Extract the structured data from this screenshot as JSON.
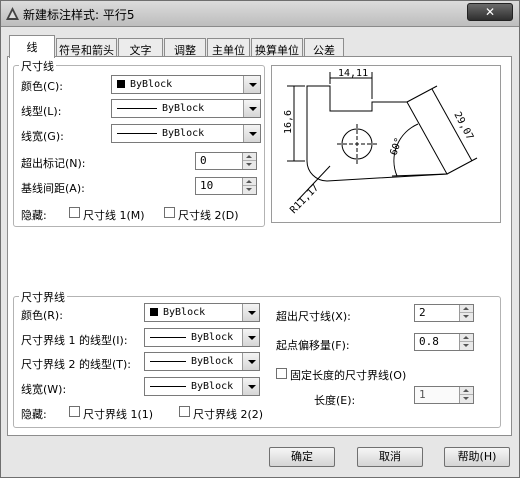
{
  "window": {
    "title": "新建标注样式: 平行5",
    "close_label": "✕"
  },
  "tabs": [
    "线",
    "符号和箭头",
    "文字",
    "调整",
    "主单位",
    "换算单位",
    "公差"
  ],
  "dim_lines": {
    "group_title": "尺寸线",
    "color_label": "颜色(C):",
    "color_value": "ByBlock",
    "linetype_label": "线型(L):",
    "linetype_value": "ByBlock",
    "lineweight_label": "线宽(G):",
    "lineweight_value": "ByBlock",
    "extend_label": "超出标记(N):",
    "extend_value": "0",
    "baseline_label": "基线间距(A):",
    "baseline_value": "10",
    "suppress_label": "隐藏:",
    "suppress1_label": "尺寸线 1(M)",
    "suppress2_label": "尺寸线 2(D)"
  },
  "preview": {
    "dim_top": "14,11",
    "dim_left": "16,6",
    "dim_slant": "29,07",
    "dim_angle": "60°",
    "dim_radius": "R11,17"
  },
  "ext_lines": {
    "group_title": "尺寸界线",
    "color_label": "颜色(R):",
    "color_value": "ByBlock",
    "linetype1_label": "尺寸界线 1 的线型(I):",
    "linetype1_value": "ByBlock",
    "linetype2_label": "尺寸界线 2 的线型(T):",
    "linetype2_value": "ByBlock",
    "lineweight_label": "线宽(W):",
    "lineweight_value": "ByBlock",
    "suppress_label": "隐藏:",
    "suppress1_label": "尺寸界线 1(1)",
    "suppress2_label": "尺寸界线 2(2)",
    "beyond_label": "超出尺寸线(X):",
    "beyond_value": "2",
    "offset_label": "起点偏移量(F):",
    "offset_value": "0.8",
    "fixed_label": "固定长度的尺寸界线(O)",
    "length_label": "长度(E):",
    "length_value": "1"
  },
  "buttons": {
    "ok": "确定",
    "cancel": "取消",
    "help": "帮助(H)"
  }
}
